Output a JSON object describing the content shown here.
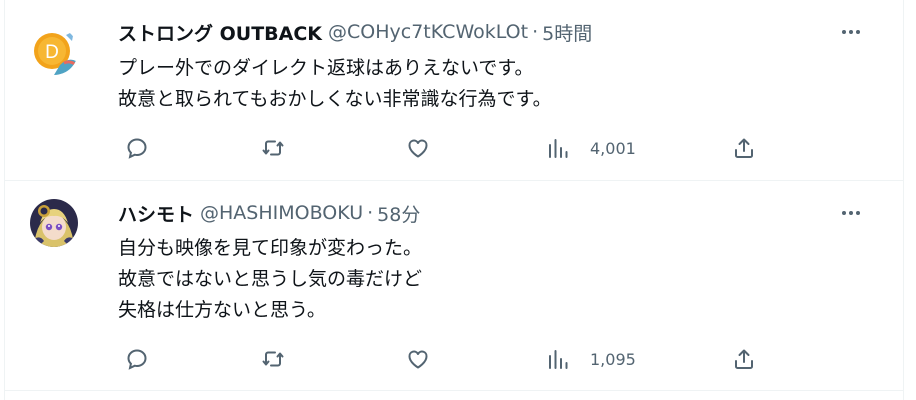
{
  "tweets": [
    {
      "display_name": "ストロング OUTBACK",
      "handle": "@COHyc7tKCWokLOt",
      "separator": "·",
      "time": "5時間",
      "text_lines": [
        "プレー外でのダイレクト返球はありえないです。",
        "故意と取られてもおかしくない非常識な行為です。"
      ],
      "views": "4,001",
      "avatar_letter": "D"
    },
    {
      "display_name": "ハシモト",
      "handle": "@HASHIMOBOKU",
      "separator": "·",
      "time": "58分",
      "text_lines": [
        "自分も映像を見て印象が変わった。",
        "故意ではないと思うし気の毒だけど",
        "失格は仕方ないと思う。"
      ],
      "views": "1,095"
    }
  ],
  "icons": {
    "more": "more-icon",
    "reply": "reply-icon",
    "retweet": "retweet-icon",
    "like": "heart-icon",
    "views": "views-icon",
    "share": "share-icon"
  },
  "colors": {
    "text": "#0f1419",
    "secondary": "#536471",
    "border": "#eff3f4"
  }
}
